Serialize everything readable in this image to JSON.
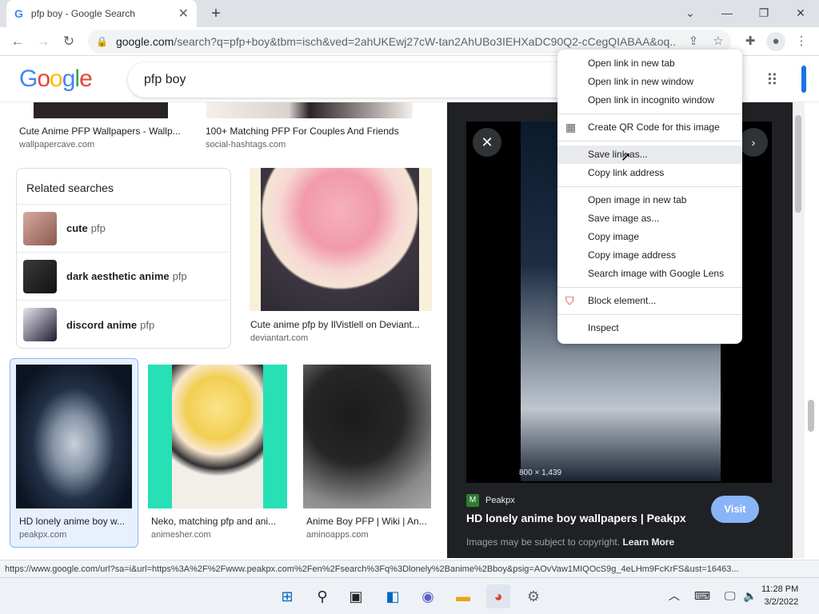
{
  "browser": {
    "tab_title": "pfp boy - Google Search",
    "tab_close": "✕",
    "new_tab": "+",
    "url_host": "google.com",
    "url_rest": "/search?q=pfp+boy&tbm=isch&ved=2ahUKEwj27cW-tan2AhUBo3IEHXaDC90Q2-cCegQIABAA&oq...",
    "window_buttons": {
      "chevron": "⌄",
      "minimize": "—",
      "restore": "❐",
      "close": "✕"
    },
    "nav": {
      "back": "←",
      "forward": "→",
      "reload": "↻"
    }
  },
  "google": {
    "logo": "Google",
    "query": "pfp boy"
  },
  "results": {
    "top_row": [
      {
        "caption": "Cute Anime PFP Wallpapers - Wallp...",
        "source": "wallpapercave.com"
      },
      {
        "caption": "100+ Matching PFP For Couples And Friends",
        "source": "social-hashtags.com"
      }
    ],
    "related": {
      "heading": "Related searches",
      "items": [
        {
          "bold": "cute",
          "rest": "pfp"
        },
        {
          "bold": "dark aesthetic anime",
          "rest": "pfp"
        },
        {
          "bold": "discord anime",
          "rest": "pfp"
        }
      ]
    },
    "deviant": {
      "caption": "Cute anime pfp by IlVistlell on Deviant...",
      "source": "deviantart.com"
    },
    "bottom_row": [
      {
        "caption": "HD lonely anime boy w...",
        "source": "peakpx.com"
      },
      {
        "caption": "Neko, matching pfp and ani...",
        "source": "animesher.com"
      },
      {
        "caption": "Anime Boy PFP | Wiki | An...",
        "source": "aminoapps.com"
      }
    ]
  },
  "viewer": {
    "close": "✕",
    "next": "›",
    "dimensions": "800 × 1,439",
    "site": "Peakpx",
    "title": "HD lonely anime boy wallpapers | Peakpx",
    "visit": "Visit",
    "copyright": "Images may be subject to copyright.",
    "learn_more": "Learn More"
  },
  "context_menu": {
    "items": [
      "Open link in new tab",
      "Open link in new window",
      "Open link in incognito window",
      "Create QR Code for this image",
      "Save link as...",
      "Copy link address",
      "Open image in new tab",
      "Save image as...",
      "Copy image",
      "Copy image address",
      "Search image with Google Lens",
      "Block element...",
      "Inspect"
    ]
  },
  "status_url": "https://www.google.com/url?sa=i&url=https%3A%2F%2Fwww.peakpx.com%2Fen%2Fsearch%3Fq%3Dlonely%2Banime%2Bboy&psig=AOvVaw1MIQOcS9g_4eLHm9FcKrFS&ust=16463...",
  "taskbar": {
    "time": "11:28 PM",
    "date": "3/2/2022"
  }
}
